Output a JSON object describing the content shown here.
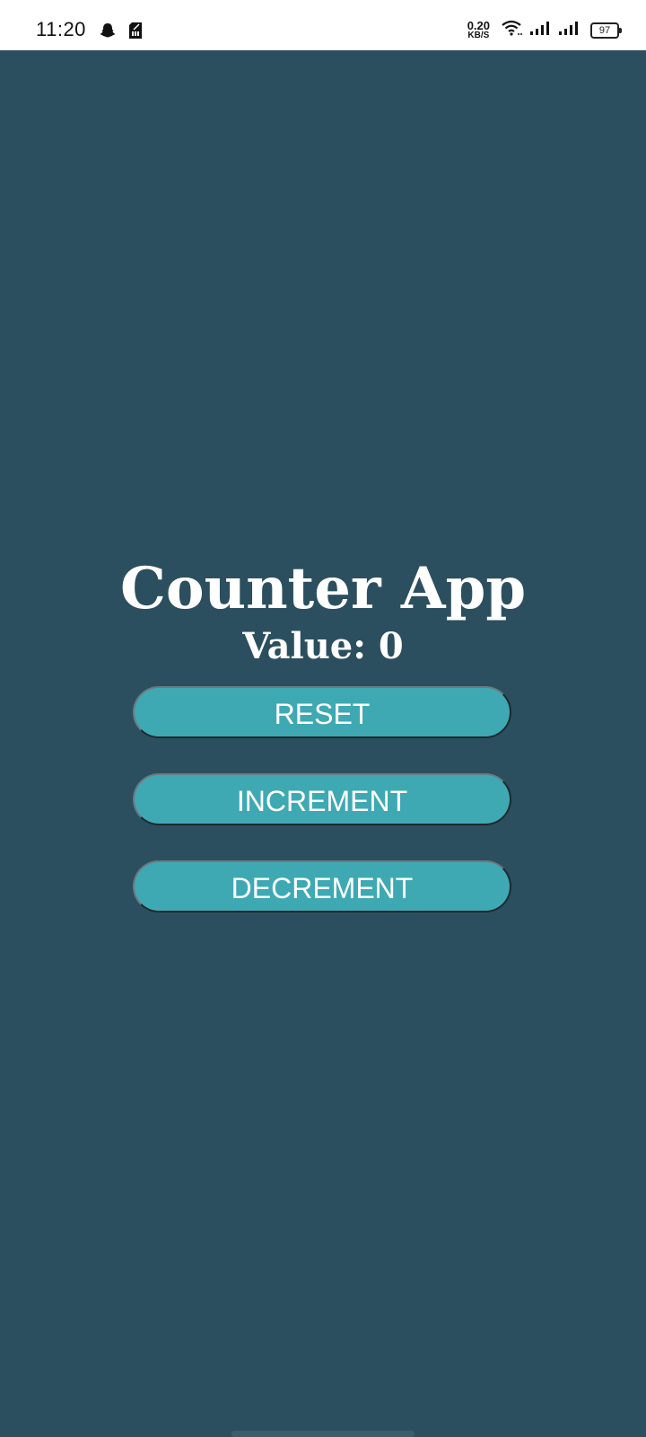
{
  "status_bar": {
    "time": "11:20",
    "net_speed_value": "0.20",
    "net_speed_unit": "KB/S",
    "battery_level": "97",
    "icons": [
      "snapchat-icon",
      "sd-card-icon",
      "wifi-icon",
      "signal-icon",
      "signal-icon",
      "battery-icon"
    ]
  },
  "app": {
    "title": "Counter App",
    "value_line": "Value: 0",
    "value_label": "Value:",
    "value": 0
  },
  "buttons": {
    "reset": "RESET",
    "increment": "INCREMENT",
    "decrement": "DECREMENT"
  },
  "colors": {
    "background": "#2c4f5f",
    "button": "#3fa9b3",
    "text": "#ffffff",
    "status_bar": "#ffffff"
  }
}
